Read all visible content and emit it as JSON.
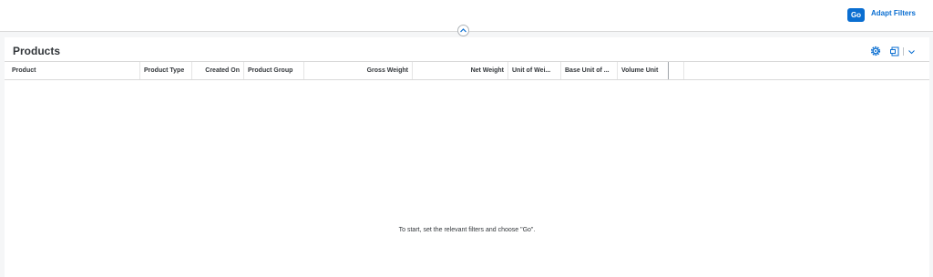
{
  "header": {
    "go_label": "Go",
    "adapt_label": "Adapt Filters"
  },
  "panel": {
    "title": "Products"
  },
  "table": {
    "columns": [
      "Product",
      "Product Type",
      "Created On",
      "Product Group",
      "Gross Weight",
      "Net Weight",
      "Unit of Wei...",
      "Base Unit of ...",
      "Volume Unit"
    ],
    "empty_text": "To start, set the relevant filters and choose \"Go\"."
  },
  "icons": [
    "chevron-up-icon",
    "settings-icon",
    "export-icon",
    "chevron-down-icon"
  ],
  "colors": {
    "accent": "#0a6ed1",
    "background": "#f5f6f7"
  }
}
